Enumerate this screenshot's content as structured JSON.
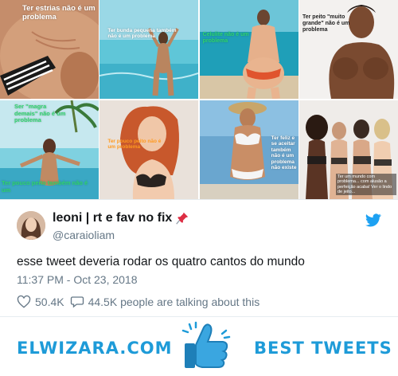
{
  "grid": {
    "tiles": [
      {
        "caption": "Ter estrias não é um problema"
      },
      {
        "caption": "Ter bunda pequena também não é um problema"
      },
      {
        "caption": "Celulite não é um problema"
      },
      {
        "caption": "Ter peito \"muito grande\" não é um problema"
      },
      {
        "caption": "Ser \"magra demais\" não é um problema",
        "caption2": "Ter pouco peito também não é um"
      },
      {
        "caption": "Ter pouco peito não é um problema"
      },
      {
        "caption": "Ter feliz e se aceitar também não é um problema não existe"
      },
      {
        "caption": "Ter um mundo com problema... com alusão a perfeição acaba! Ver o lindo de jeito..."
      }
    ]
  },
  "tweet": {
    "display_name": "leoni | rt e fav no fix",
    "handle": "@caraioliam",
    "text": "esse tweet deveria rodar os quatro cantos do mundo",
    "timestamp": "11:37 PM - Oct 23, 2018",
    "likes": "50.4K",
    "talking": "44.5K people are talking about this"
  },
  "banner": {
    "left_text": "ELWIZARA.COM",
    "right_text": "BEST TWEETS"
  },
  "colors": {
    "brand_blue": "#1e9bd8",
    "twitter_blue": "#1da1f2",
    "muted": "#657786"
  },
  "icons": {
    "pin": "pushpin-icon",
    "bird": "twitter-bird-icon",
    "like": "heart-icon",
    "reply": "speech-bubble-icon",
    "thumbs": "thumbs-up-icon"
  }
}
